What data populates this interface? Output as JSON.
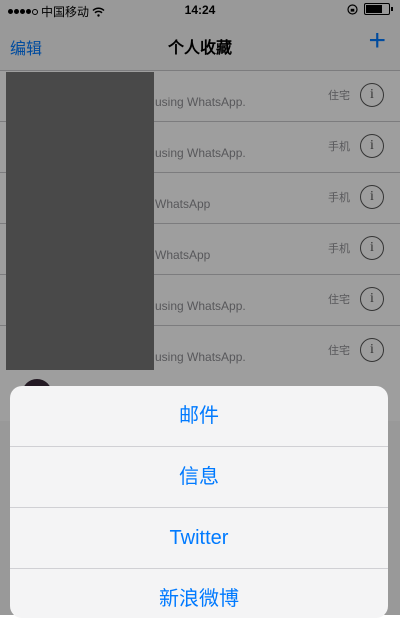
{
  "status_bar": {
    "carrier": "中国移动",
    "time": "14:24"
  },
  "nav": {
    "edit_label": "编辑",
    "title": "个人收藏",
    "add_label": "+"
  },
  "favorites": [
    {
      "subtitle": "using WhatsApp.",
      "type": "住宅"
    },
    {
      "subtitle": "using WhatsApp.",
      "type": "手机"
    },
    {
      "subtitle": "WhatsApp",
      "type": "手机"
    },
    {
      "subtitle": "WhatsApp",
      "type": "手机"
    },
    {
      "subtitle": "using WhatsApp.",
      "type": "住宅"
    },
    {
      "subtitle": "using WhatsApp.",
      "type": "住宅"
    }
  ],
  "info_glyph": "i",
  "action_sheet": {
    "items": [
      "邮件",
      "信息",
      "Twitter",
      "新浪微博"
    ]
  },
  "colors": {
    "accent": "#007aff",
    "dim_overlay": "rgba(0,0,0,0.38)",
    "redaction": "#777777"
  }
}
